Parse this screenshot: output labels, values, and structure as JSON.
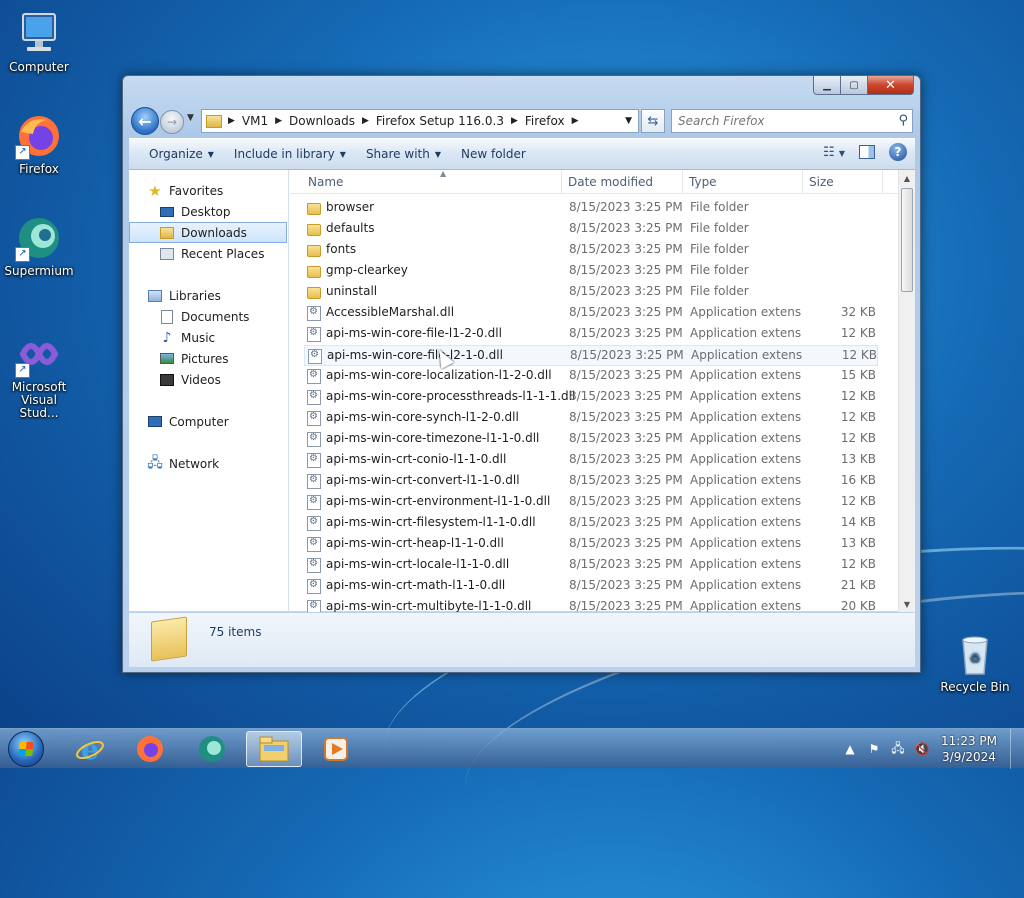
{
  "desktop": {
    "icons": [
      {
        "label": "Computer"
      },
      {
        "label": "Firefox"
      },
      {
        "label": "Supermium"
      },
      {
        "label": "Microsoft Visual Stud..."
      },
      {
        "label": "Recycle Bin"
      }
    ]
  },
  "window": {
    "address": {
      "crumbs": [
        "VM1",
        "Downloads",
        "Firefox Setup 116.0.3",
        "Firefox"
      ]
    },
    "search": {
      "placeholder": "Search Firefox"
    },
    "toolbar": {
      "organize": "Organize",
      "include_in_library": "Include in library",
      "share_with": "Share with",
      "new_folder": "New folder"
    },
    "nav": {
      "favorites": "Favorites",
      "desktop": "Desktop",
      "downloads": "Downloads",
      "recent_places": "Recent Places",
      "libraries": "Libraries",
      "documents": "Documents",
      "music": "Music",
      "pictures": "Pictures",
      "videos": "Videos",
      "computer": "Computer",
      "network": "Network"
    },
    "columns": {
      "name": "Name",
      "date": "Date modified",
      "type": "Type",
      "size": "Size"
    },
    "files": [
      {
        "name": "browser",
        "date": "8/15/2023 3:25 PM",
        "type": "File folder",
        "size": "",
        "kind": "folder"
      },
      {
        "name": "defaults",
        "date": "8/15/2023 3:25 PM",
        "type": "File folder",
        "size": "",
        "kind": "folder"
      },
      {
        "name": "fonts",
        "date": "8/15/2023 3:25 PM",
        "type": "File folder",
        "size": "",
        "kind": "folder"
      },
      {
        "name": "gmp-clearkey",
        "date": "8/15/2023 3:25 PM",
        "type": "File folder",
        "size": "",
        "kind": "folder"
      },
      {
        "name": "uninstall",
        "date": "8/15/2023 3:25 PM",
        "type": "File folder",
        "size": "",
        "kind": "folder"
      },
      {
        "name": "AccessibleMarshal.dll",
        "date": "8/15/2023 3:25 PM",
        "type": "Application extens...",
        "size": "32 KB",
        "kind": "dll"
      },
      {
        "name": "api-ms-win-core-file-l1-2-0.dll",
        "date": "8/15/2023 3:25 PM",
        "type": "Application extens...",
        "size": "12 KB",
        "kind": "dll"
      },
      {
        "name": "api-ms-win-core-file-l2-1-0.dll",
        "date": "8/15/2023 3:25 PM",
        "type": "Application extens...",
        "size": "12 KB",
        "kind": "dll"
      },
      {
        "name": "api-ms-win-core-localization-l1-2-0.dll",
        "date": "8/15/2023 3:25 PM",
        "type": "Application extens...",
        "size": "15 KB",
        "kind": "dll"
      },
      {
        "name": "api-ms-win-core-processthreads-l1-1-1.dll",
        "date": "8/15/2023 3:25 PM",
        "type": "Application extens...",
        "size": "12 KB",
        "kind": "dll"
      },
      {
        "name": "api-ms-win-core-synch-l1-2-0.dll",
        "date": "8/15/2023 3:25 PM",
        "type": "Application extens...",
        "size": "12 KB",
        "kind": "dll"
      },
      {
        "name": "api-ms-win-core-timezone-l1-1-0.dll",
        "date": "8/15/2023 3:25 PM",
        "type": "Application extens...",
        "size": "12 KB",
        "kind": "dll"
      },
      {
        "name": "api-ms-win-crt-conio-l1-1-0.dll",
        "date": "8/15/2023 3:25 PM",
        "type": "Application extens...",
        "size": "13 KB",
        "kind": "dll"
      },
      {
        "name": "api-ms-win-crt-convert-l1-1-0.dll",
        "date": "8/15/2023 3:25 PM",
        "type": "Application extens...",
        "size": "16 KB",
        "kind": "dll"
      },
      {
        "name": "api-ms-win-crt-environment-l1-1-0.dll",
        "date": "8/15/2023 3:25 PM",
        "type": "Application extens...",
        "size": "12 KB",
        "kind": "dll"
      },
      {
        "name": "api-ms-win-crt-filesystem-l1-1-0.dll",
        "date": "8/15/2023 3:25 PM",
        "type": "Application extens...",
        "size": "14 KB",
        "kind": "dll"
      },
      {
        "name": "api-ms-win-crt-heap-l1-1-0.dll",
        "date": "8/15/2023 3:25 PM",
        "type": "Application extens...",
        "size": "13 KB",
        "kind": "dll"
      },
      {
        "name": "api-ms-win-crt-locale-l1-1-0.dll",
        "date": "8/15/2023 3:25 PM",
        "type": "Application extens...",
        "size": "12 KB",
        "kind": "dll"
      },
      {
        "name": "api-ms-win-crt-math-l1-1-0.dll",
        "date": "8/15/2023 3:25 PM",
        "type": "Application extens...",
        "size": "21 KB",
        "kind": "dll"
      },
      {
        "name": "api-ms-win-crt-multibyte-l1-1-0.dll",
        "date": "8/15/2023 3:25 PM",
        "type": "Application extens...",
        "size": "20 KB",
        "kind": "dll"
      }
    ],
    "status": {
      "item_count": "75 items"
    }
  },
  "taskbar": {
    "clock_time": "11:23 PM",
    "clock_date": "3/9/2024"
  },
  "colors": {
    "accent": "#1569b4",
    "selection": "#cce4fb"
  }
}
